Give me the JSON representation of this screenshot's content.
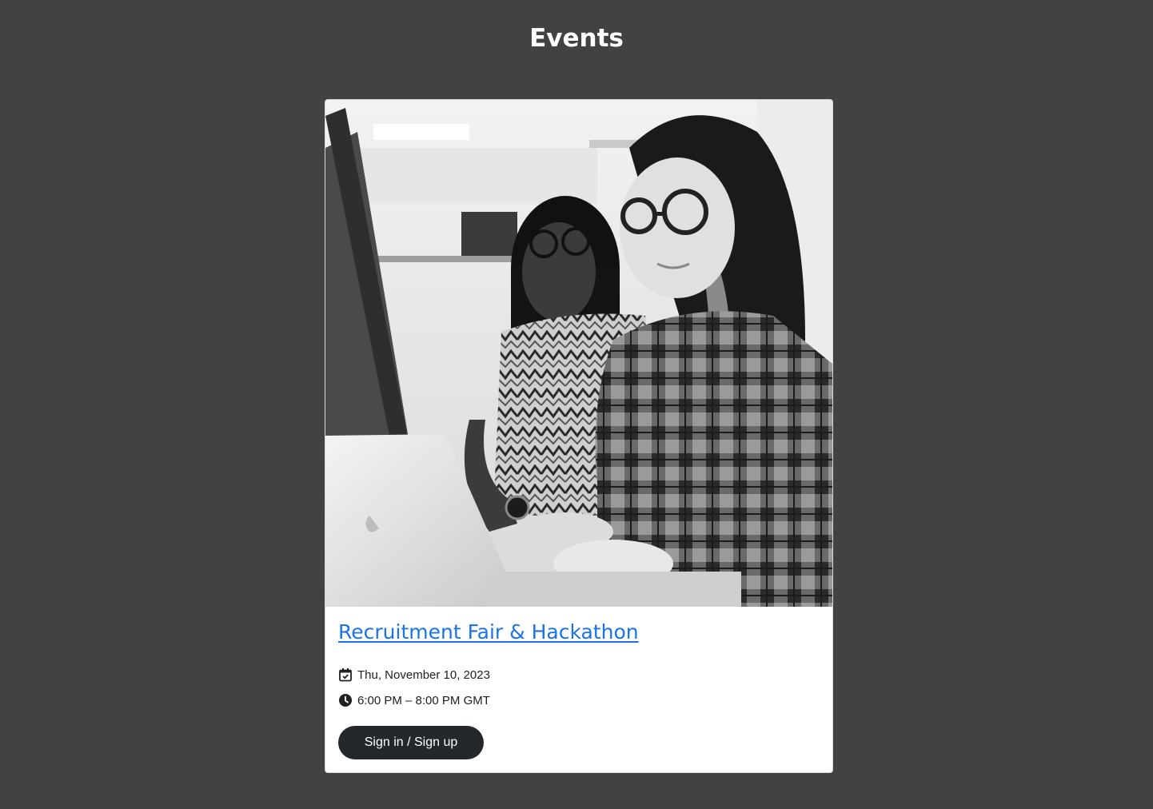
{
  "header": {
    "title": "Events"
  },
  "event": {
    "title": "Recruitment Fair & Hackathon",
    "date": "Thu, November 10, 2023",
    "time": "6:00 PM – 8:00 PM GMT",
    "button_label": "Sign in / Sign up",
    "photo_icon": "photo-two-women-at-computer",
    "date_icon": "calendar-check-icon",
    "time_icon": "clock-icon"
  },
  "colors": {
    "background": "#424242",
    "card": "#ffffff",
    "link": "#1a73e8",
    "button": "#24282d",
    "text": "#212121"
  }
}
